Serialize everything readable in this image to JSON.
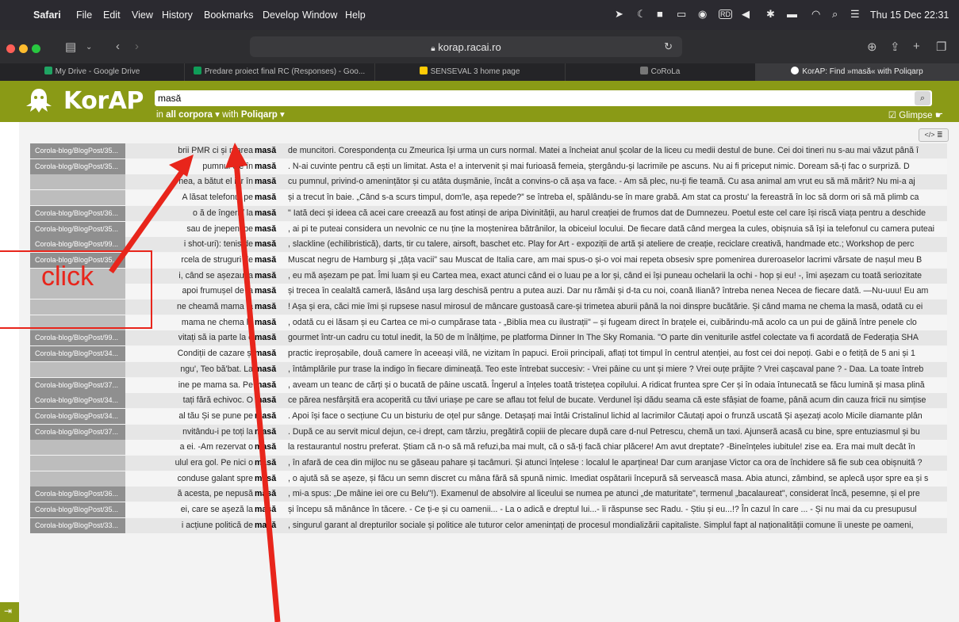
{
  "menubar": {
    "app": "Safari",
    "menus": [
      "File",
      "Edit",
      "View",
      "History",
      "Bookmarks",
      "Develop",
      "Window",
      "Help"
    ],
    "clock": "Thu 15 Dec 22:31"
  },
  "toolbar": {
    "url": "korap.racai.ro"
  },
  "tabs": [
    {
      "label": "My Drive - Google Drive",
      "color": "#1fa463"
    },
    {
      "label": "Predare proiect final RC (Responses) - Goo...",
      "color": "#0f9d58"
    },
    {
      "label": "SENSEVAL 3 home page",
      "color": "#ffcb05"
    },
    {
      "label": "CoRoLa",
      "color": "#777777"
    },
    {
      "label": "KorAP: Find »masă« with Poliqarp",
      "color": "#ffffff"
    }
  ],
  "header": {
    "logo": "KorAP",
    "query": "masă",
    "scope_prefix": "in",
    "scope_corpus": "all corpora",
    "scope_with": "with",
    "scope_ql": "Poliqarp",
    "glimpse": "Glimpse",
    "brand_color": "#8a9a16"
  },
  "results": [
    {
      "doc": "Corola-blog/BlogPost/35...",
      "left": "brii PMR ci și marea",
      "match": "masă",
      "right": "de muncitori. Corespondența cu Zmeurica își urma un curs normal. Matei a încheiat anul școlar de la liceu cu medii destul de bune. Cei doi tineri nu s-au mai văzut până î"
    },
    {
      "doc": "Corola-blog/BlogPost/35...",
      "left": "pumnul c       e în",
      "match": "masă",
      "right": ". N-ai cuvinte pentru că ești un limitat. Asta e! a intervenit și mai furioasă femeia, ștergându-și lacrimile pe ascuns. Nu ai fi priceput nimic. Doream să-ți fac o surpriză. D"
    },
    {
      "doc": "",
      "left": "nea, a bătut el iar în",
      "match": "masă",
      "right": "cu pumnul, privind-o amenințător și cu atâta dușmănie, încât a convins-o că așa va face. - Am să plec, nu-ți fie teamă. Cu asa animal am vrut eu să mă mărit? Nu mi-a aj"
    },
    {
      "doc": "",
      "left": "A lăsat telefonul pe",
      "match": "masă",
      "right": "și a trecut în baie. „Când s-a scurs timpul, dom'le, așa repede?” se întreba el, spălându-se în mare grabă. Am stat ca prostu' la fereastră în loc să dorm ori să mă plimb ca"
    },
    {
      "doc": "Corola-blog/BlogPost/36...",
      "left": "o      ă de îngeri / la",
      "match": "masă",
      "right": "\" Iată deci și ideea că acei care creează au fost atinși de aripa Divinității, au harul creației de frumos dat de Dumnezeu. Poetul este cel care își riscă viața pentru a deschide"
    },
    {
      "doc": "Corola-blog/BlogPost/35...",
      "left": "sau de jnepeni pe",
      "match": "masă",
      "right": ", ai pi te puteai considera un nevolnic ce nu ține la moștenirea bătrânilor, la obiceiul locului. De fiecare dată când mergea la cules, obișnuia să își ia telefonul cu camera puteai"
    },
    {
      "doc": "Corola-blog/BlogPost/99...",
      "left": "i shot-uri): tenis de",
      "match": "masă",
      "right": ", slackline (echilibristică), darts, tir cu talere, airsoft, baschet etc. Play for Art - expoziții de artă și ateliere de creație, reciclare creativă, handmade etc.; Workshop de perc"
    },
    {
      "doc": "Corola-blog/BlogPost/35...",
      "left": "rcela de struguri de",
      "match": "masă",
      "right": "Muscat negru de Hamburg și „țâța vacii\" sau Muscat de Italia care, am mai spus-o și-o voi mai repeta obsesiv spre pomenirea dureroaselor lacrimi vărsate de nașul meu B"
    },
    {
      "doc": "",
      "left": "i, când se așezau la",
      "match": "masă",
      "right": ", eu mă așezam pe pat. Îmi luam și eu Cartea mea, exact atunci când ei o luau pe a lor și, când ei își puneau ochelarii la ochi - hop și eu! -, îmi așezam cu toată seriozitate"
    },
    {
      "doc": "",
      "left": "apoi frumușel de la",
      "match": "masă",
      "right": "și trecea în cealaltă cameră, lăsând ușa larg deschisă pentru a putea auzi. Dar nu rămâi și d-ta cu noi, coană Iliană? întreba nenea Necea de fiecare dată. —Nu-uuu! Eu am"
    },
    {
      "doc": "",
      "left": "ne cheamă mama la",
      "match": "masă",
      "right": "! Așa și era, căci mie îmi și rupsese nasul mirosul de mâncare gustoasă care-și trimetea aburii până la noi dinspre bucătărie. Și când mama ne chema la masă, odată cu ei"
    },
    {
      "doc": "",
      "left": "mama ne chema la",
      "match": "masă",
      "right": ", odată cu ei lăsam și eu Cartea ce mi-o cumpărase tata - „Biblia mea cu ilustrații\" – și fugeam direct în brațele ei, cuibărindu-mă acolo ca un pui de găină între penele clo"
    },
    {
      "doc": "Corola-blog/BlogPost/99...",
      "left": "vitați să ia parte la o",
      "match": "masă",
      "right": "gourmet într-un cadru cu totul inedit, la 50 de m înălțime, pe platforma Dinner In The Sky Romania. \"O parte din veniturile astfel colectate va fi acordată de Federația SHA"
    },
    {
      "doc": "Corola-blog/BlogPost/34...",
      "left": "Condiții de cazare și",
      "match": "masă",
      "right": "practic ireproșabile, două camere în aceeași vilă, ne vizitam în papuci. Eroii principali, aflați tot timpul în centrul atenției, au fost cei doi nepoți. Gabi e o fetiță de 5 ani și 1"
    },
    {
      "doc": "",
      "left": "ngu', Teo bă'bat. La",
      "match": "masă",
      "right": ", întâmplările pur trase la indigo în fiecare dimineață. Teo este întrebat succesiv: - Vrei pâine cu unt și miere ? Vrei ouțe prăjite ? Vrei cașcaval pane ? - Daa. La toate întreb"
    },
    {
      "doc": "Corola-blog/BlogPost/37...",
      "left": "ine pe mama sa. Pe",
      "match": "masă",
      "right": ", aveam un teanc de cărți și o bucată de pâine uscată. Îngerul a înțeles toată tristețea copilului. A ridicat fruntea spre Cer și în odaia întunecată se făcu lumină și masa plină"
    },
    {
      "doc": "Corola-blog/BlogPost/34...",
      "left": "tați fără echivoc. O",
      "match": "masă",
      "right": "ce părea nesfârșită era acoperită cu tăvi uriașe pe care se aflau tot felul de bucate. Verdunel își dădu seama că este sfâșiat de foame, până acum din cauza fricii nu simțise"
    },
    {
      "doc": "Corola-blog/BlogPost/34...",
      "left": "al tău Și se pune pe",
      "match": "masă",
      "right": ". Apoi își face o secțiune Cu un bisturiu de oțel pur sânge. Detașați mai întâi Cristalinul lichid al lacrimilor Căutați apoi o frunză uscată Și așezați acolo Micile diamante plân"
    },
    {
      "doc": "Corola-blog/BlogPost/37...",
      "left": "nvitându-i pe toți la",
      "match": "masă",
      "right": ". După ce au servit micul dejun, ce-i drept, cam târziu, pregătiră copiii de plecare după care d-nul Petrescu, chemă un taxi. Ajunseră acasă cu bine, spre entuziasmul și bu"
    },
    {
      "doc": "",
      "left": "a ei. -Am rezervat o",
      "match": "masă",
      "right": "la restaurantul nostru preferat. Știam că n-o să mă refuzi,ba mai mult, că o să-ți facă chiar plăcere! Am avut dreptate? -Bineînțeles iubitule! zise ea. Era mai mult decât în"
    },
    {
      "doc": "",
      "left": "ulul era gol. Pe nici o",
      "match": "masă",
      "right": ", în afară de cea din mijloc nu se găseau pahare și tacâmuri. Și atunci înțelese : localul le aparținea! Dar cum aranjase Victor ca ora de închidere să fie sub cea obișnuită ?"
    },
    {
      "doc": "",
      "left": "conduse galant spre",
      "match": "masă",
      "right": ", o ajută să se așeze, și făcu un semn discret cu mâna fără să spună nimic. Imediat ospătarii începură să servească masa. Abia atunci, zâmbind, se aplecă ușor spre ea și s"
    },
    {
      "doc": "Corola-blog/BlogPost/36...",
      "left": "ă acesta, pe nepusă",
      "match": "masă",
      "right": ", mi-a spus: „De mâine iei ore cu Belu\"!). Examenul de absolvire al liceului se numea pe atunci „de maturitate\", termenul „bacalaureat\", considerat încă, pesemne, și el pre"
    },
    {
      "doc": "Corola-blog/BlogPost/35...",
      "left": "ei, care se așeză la",
      "match": "masă",
      "right": "și începu să mănânce în tăcere. - Ce ți-e și cu oamenii... - La o adică e dreptul lui...- îi răspunse sec Radu. - Știu și eu...!? În cazul în care ... - Și nu mai da cu presupusul"
    },
    {
      "doc": "Corola-blog/BlogPost/33...",
      "left": "i acțiune politică de",
      "match": "masă",
      "right": ", singurul garant al drepturilor sociale și politice ale tuturor celor amenințați de procesul mondializării capitaliste. Simplul fapt al naționalității comune îi uneste pe oameni,"
    }
  ],
  "annotation": {
    "label": "click",
    "color": "#e8251b"
  }
}
